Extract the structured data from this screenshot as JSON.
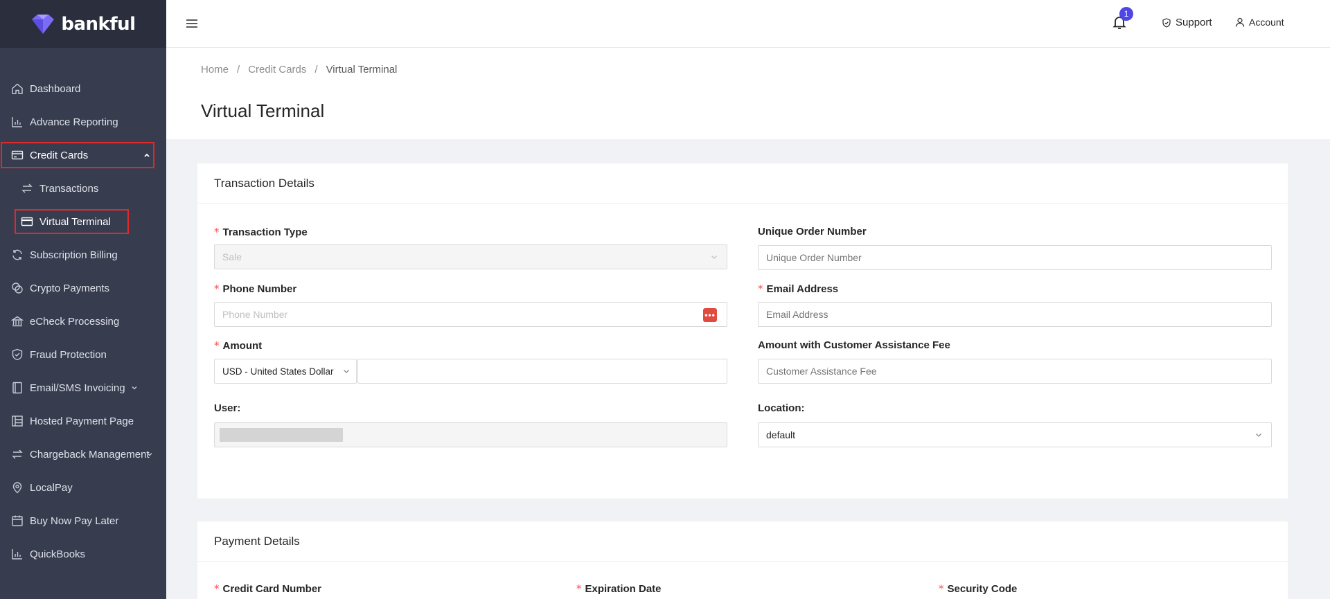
{
  "brand": {
    "name": "bankful"
  },
  "sidebar": {
    "items": [
      {
        "label": "Dashboard",
        "icon": "home-icon"
      },
      {
        "label": "Advance Reporting",
        "icon": "bar-chart-icon"
      },
      {
        "label": "Credit Cards",
        "icon": "credit-card-icon",
        "expanded": true
      },
      {
        "label": "Transactions",
        "icon": "swap-icon"
      },
      {
        "label": "Virtual Terminal",
        "icon": "card-icon",
        "active": true
      },
      {
        "label": "Subscription Billing",
        "icon": "sync-icon"
      },
      {
        "label": "Crypto Payments",
        "icon": "coins-icon"
      },
      {
        "label": "eCheck Processing",
        "icon": "bank-icon"
      },
      {
        "label": "Fraud Protection",
        "icon": "shield-icon"
      },
      {
        "label": "Email/SMS Invoicing",
        "icon": "document-icon"
      },
      {
        "label": "Hosted Payment Page",
        "icon": "layout-icon"
      },
      {
        "label": "Chargeback Management",
        "icon": "swap-icon"
      },
      {
        "label": "LocalPay",
        "icon": "map-pin-icon"
      },
      {
        "label": "Buy Now Pay Later",
        "icon": "calendar-icon"
      },
      {
        "label": "QuickBooks",
        "icon": "bar-chart-icon"
      }
    ]
  },
  "header": {
    "notification_count": "1",
    "support_label": "Support",
    "account_label": "Account"
  },
  "breadcrumb": {
    "home": "Home",
    "section": "Credit Cards",
    "current": "Virtual Terminal",
    "separator": "/"
  },
  "page": {
    "title": "Virtual Terminal"
  },
  "transaction_details": {
    "heading": "Transaction Details",
    "transaction_type": {
      "label": "Transaction Type",
      "value": "Sale"
    },
    "unique_order": {
      "label": "Unique Order Number",
      "placeholder": "Unique Order Number"
    },
    "phone": {
      "label": "Phone Number",
      "placeholder": "Phone Number"
    },
    "email": {
      "label": "Email Address",
      "placeholder": "Email Address"
    },
    "amount": {
      "label": "Amount",
      "currency": "USD - United States Dollar",
      "value": ""
    },
    "assist_fee": {
      "label": "Amount with Customer Assistance Fee",
      "placeholder": "Customer Assistance Fee"
    },
    "user": {
      "label": "User:"
    },
    "location": {
      "label": "Location:",
      "value": "default"
    }
  },
  "payment_details": {
    "heading": "Payment Details",
    "card_number": {
      "label": "Credit Card Number"
    },
    "expiration": {
      "label": "Expiration Date"
    },
    "security_code": {
      "label": "Security Code"
    }
  },
  "colors": {
    "sidebar_bg": "#373c4f",
    "highlight_box": "#e02a2a",
    "badge": "#4f46e5",
    "required": "#ff4d4f"
  }
}
